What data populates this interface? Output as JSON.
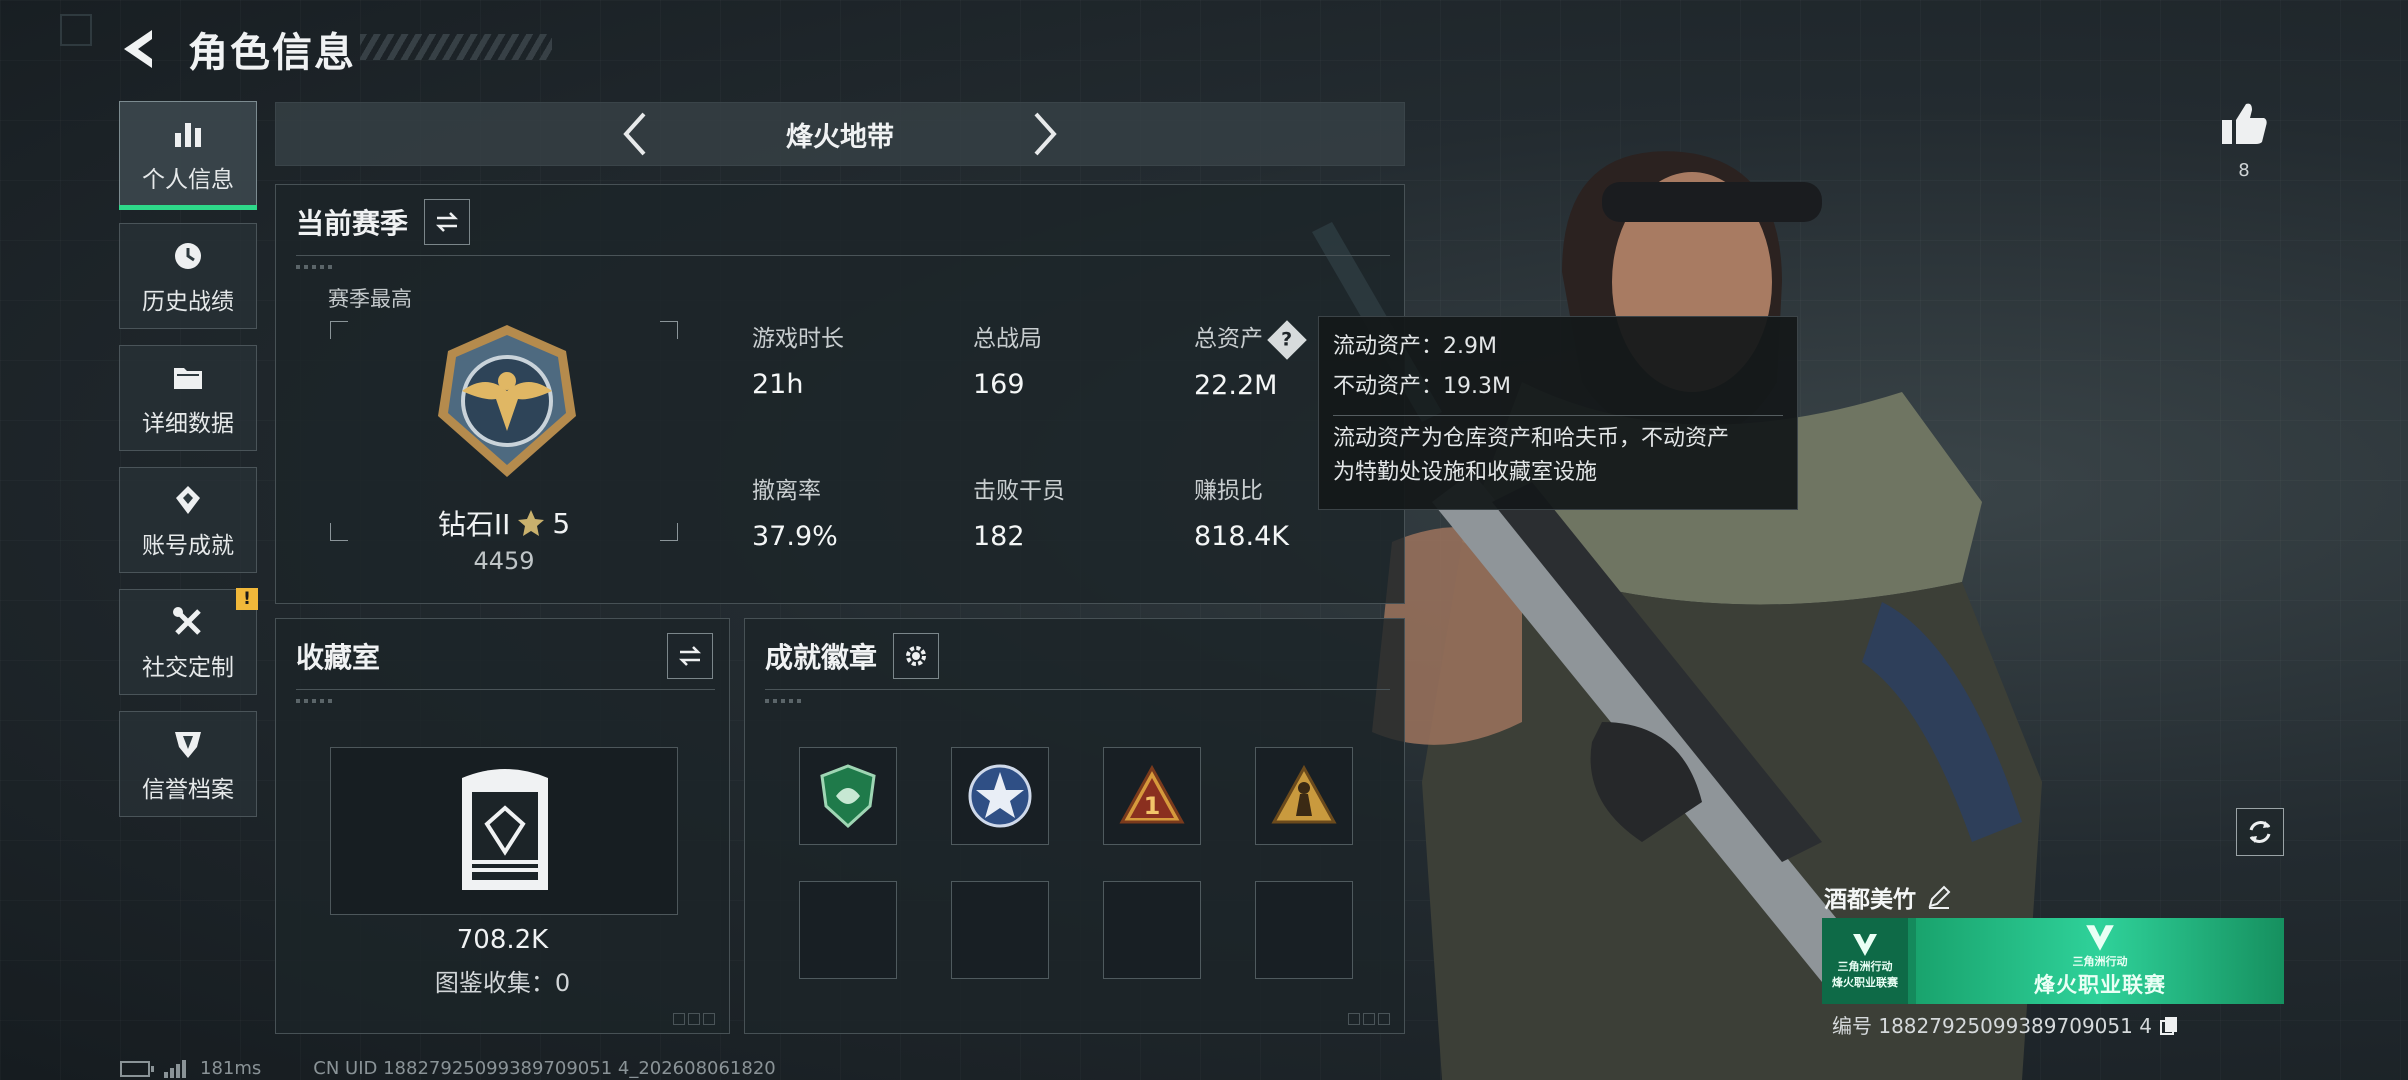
{
  "header": {
    "title": "角色信息"
  },
  "nav": {
    "items": [
      {
        "label": "个人信息",
        "icon": "bar-chart-icon",
        "active": true
      },
      {
        "label": "历史战绩",
        "icon": "history-clock-icon"
      },
      {
        "label": "详细数据",
        "icon": "folder-icon"
      },
      {
        "label": "账号成就",
        "icon": "achievement-icon"
      },
      {
        "label": "社交定制",
        "icon": "tools-icon",
        "badge": "!"
      },
      {
        "label": "信誉档案",
        "icon": "shield-icon"
      }
    ]
  },
  "mode": {
    "title": "烽火地带"
  },
  "season": {
    "title": "当前赛季",
    "best_label": "赛季最高",
    "rank_name": "钻石II",
    "rank_stars": "5",
    "rank_points": "4459",
    "stats": [
      {
        "label": "游戏时长",
        "value": "21h"
      },
      {
        "label": "总战局",
        "value": "169"
      },
      {
        "label": "总资产",
        "value": "22.2M",
        "help": "?"
      },
      {
        "label": "撤离率",
        "value": "37.9%"
      },
      {
        "label": "击败干员",
        "value": "182"
      },
      {
        "label": "赚损比",
        "value": "818.4K"
      }
    ]
  },
  "tooltip": {
    "liquid": "流动资产：2.9M",
    "fixed": "不动资产：19.3M",
    "desc_line1": "流动资产为仓库资产和哈夫币，不动资产",
    "desc_line2": "为特勤处设施和收藏室设施"
  },
  "collection": {
    "title": "收藏室",
    "value": "708.2K",
    "count": "图鉴收集：0"
  },
  "badges": {
    "title": "成就徽章",
    "filled": [
      "green-shield-badge",
      "blue-star-badge",
      "triangle-1-badge",
      "triangle-soldier-badge"
    ]
  },
  "profile": {
    "like_count": "8",
    "player_name": "酒都美竹",
    "banner_small": "烽火职业联赛",
    "banner_small_sub": "三角洲行动",
    "banner_main": "烽火职业联赛",
    "banner_main_sub": "三角洲行动",
    "player_id": "编号 18827925099389709051 4"
  },
  "status": {
    "ping": "181ms",
    "uid": "CN UID 18827925099389709051 4_202608061820"
  },
  "colors": {
    "accent_green": "#2ed98a",
    "badge_yellow": "#f1b83a"
  }
}
